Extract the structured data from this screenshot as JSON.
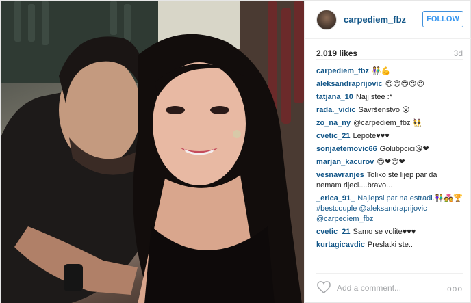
{
  "post": {
    "username": "carpediem_fbz",
    "follow_label": "FOLLOW",
    "likes": "2,019 likes",
    "time": "3d"
  },
  "comments": [
    {
      "user": "carpediem_fbz",
      "text": "👫💪"
    },
    {
      "user": "aleksandraprijovic",
      "text": "😍😍😍😍😍"
    },
    {
      "user": "tatjana_10",
      "text": "Najj stee :*"
    },
    {
      "user": "rada._vidic",
      "text": "Savršenstvo 😮"
    },
    {
      "user": "zo_na_ny",
      "text": "@carpediem_fbz 👯"
    },
    {
      "user": "cvetic_21",
      "text": "Lepote♥♥♥"
    },
    {
      "user": "sonjaetemovic66",
      "text": "Golubpcici😘❤"
    },
    {
      "user": "marjan_kacurov",
      "text": "😍❤😍❤"
    },
    {
      "user": "vesnavranjes",
      "text": "Toliko ste lijep par da nemam rijeci....bravo..."
    },
    {
      "user": "_erica_91_",
      "text": "Najlepsi par na estradi.👫💑🏆 #bestcouple @aleksandraprijovic @carpediem_fbz"
    },
    {
      "user": "cvetic_21",
      "text": "Samo se volite♥♥♥"
    },
    {
      "user": "kurtagicavdic",
      "text": "Preslatki ste.."
    }
  ],
  "footer": {
    "add_comment_placeholder": "Add a comment...",
    "more_label": "ooo"
  }
}
